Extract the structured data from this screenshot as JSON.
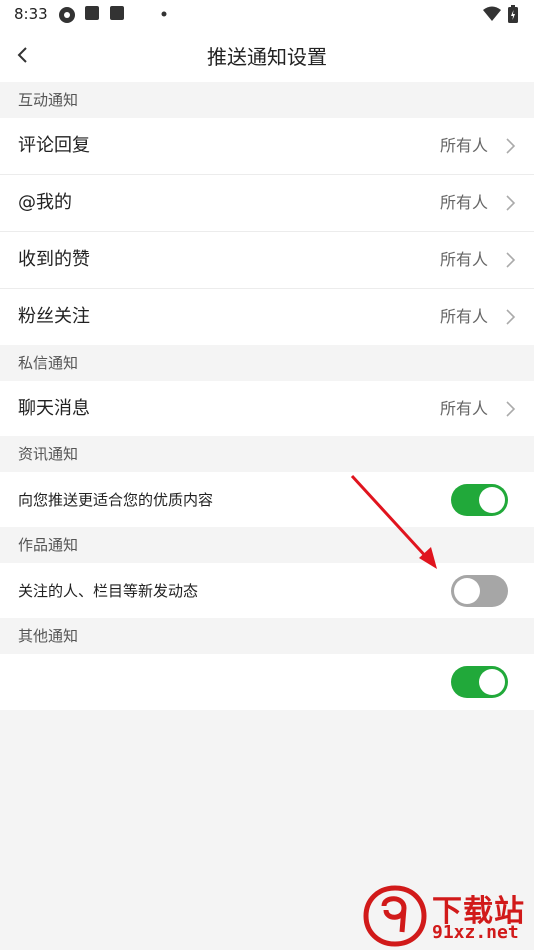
{
  "status_bar": {
    "time": "8:33"
  },
  "header": {
    "title": "推送通知设置"
  },
  "sections": {
    "interaction": {
      "title": "互动通知",
      "items": [
        {
          "label": "评论回复",
          "value": "所有人"
        },
        {
          "label": "@我的",
          "value": "所有人"
        },
        {
          "label": "收到的赞",
          "value": "所有人"
        },
        {
          "label": "粉丝关注",
          "value": "所有人"
        }
      ]
    },
    "private_message": {
      "title": "私信通知",
      "items": [
        {
          "label": "聊天消息",
          "value": "所有人"
        }
      ]
    },
    "news": {
      "title": "资讯通知",
      "items": [
        {
          "label": "向您推送更适合您的优质内容",
          "enabled": true
        }
      ]
    },
    "works": {
      "title": "作品通知",
      "items": [
        {
          "label": "关注的人、栏目等新发动态",
          "enabled": false
        }
      ]
    },
    "other": {
      "title": "其他通知",
      "items": [
        {
          "label": "",
          "enabled": true
        }
      ]
    }
  },
  "watermark": {
    "main": "下载站",
    "sub": "91xz.net"
  },
  "colors": {
    "toggle_on": "#21a93a",
    "toggle_off": "#a6a6a6",
    "annotation_arrow": "#e0141e"
  }
}
